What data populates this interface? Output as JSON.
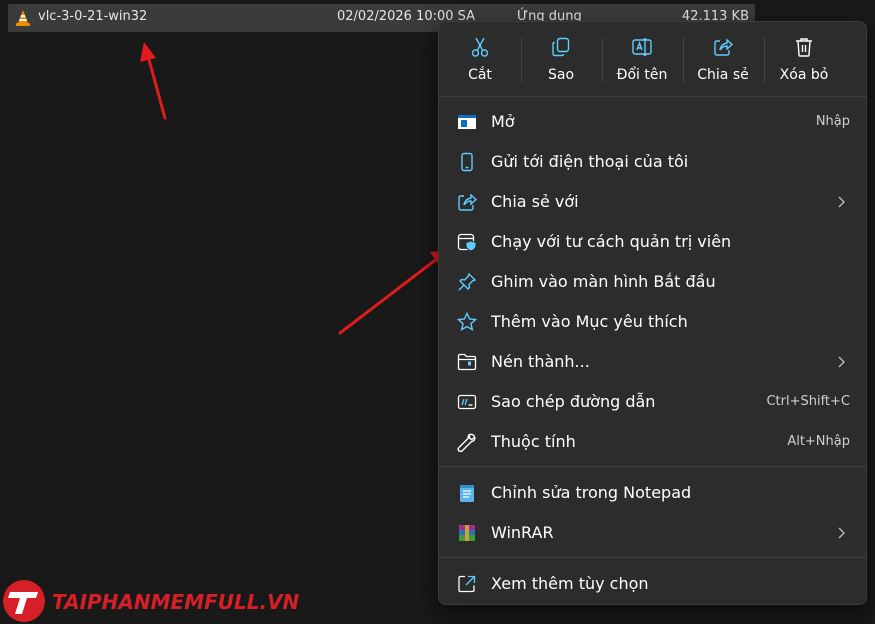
{
  "file": {
    "name": "vlc-3-0-21-win32",
    "date": "02/02/2026 10:00 SA",
    "type": "Ứng dụng",
    "size": "42.113 KB",
    "icon": "vlc-cone-icon"
  },
  "toolbar": {
    "cut": "Cắt",
    "copy": "Sao",
    "rename": "Đổi tên",
    "share": "Chia sẻ",
    "delete": "Xóa bỏ"
  },
  "menu": {
    "open": {
      "label": "Mở",
      "shortcut": "Nhập"
    },
    "send_phone": {
      "label": "Gửi tới điện thoại của tôi"
    },
    "share_with": {
      "label": "Chia sẻ với"
    },
    "run_admin": {
      "label": "Chạy với tư cách quản trị viên"
    },
    "pin_start": {
      "label": "Ghim vào màn hình Bắt đầu"
    },
    "add_fav": {
      "label": "Thêm vào Mục yêu thích"
    },
    "compress": {
      "label": "Nén thành..."
    },
    "copy_path": {
      "label": "Sao chép đường dẫn",
      "shortcut": "Ctrl+Shift+C"
    },
    "properties": {
      "label": "Thuộc tính",
      "shortcut": "Alt+Nhập"
    },
    "notepad": {
      "label": "Chỉnh sửa trong Notepad"
    },
    "winrar": {
      "label": "WinRAR"
    },
    "more": {
      "label": "Xem thêm tùy chọn"
    }
  },
  "watermark": {
    "text": "TAIPHANMEMFULL.VN"
  },
  "colors": {
    "menu_bg": "#2c2c2c",
    "accent": "#60cdff",
    "arrow": "#e01b1b"
  }
}
